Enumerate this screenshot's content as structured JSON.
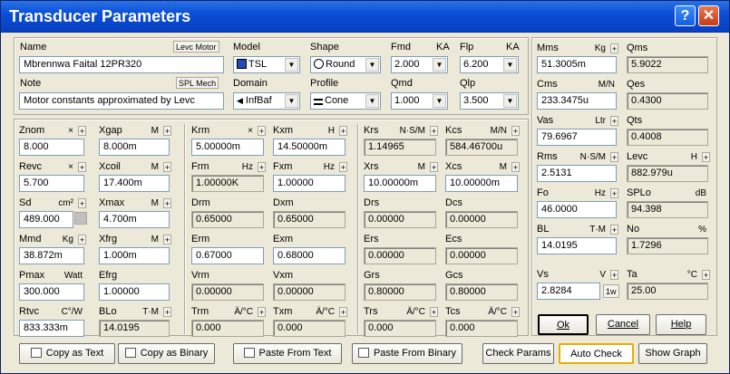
{
  "window": {
    "title": "Transducer Parameters",
    "help_glyph": "?",
    "close_glyph": "✕"
  },
  "top": {
    "name_label": "Name",
    "name_value": "Mbrennwa Faital 12PR320",
    "levc_motor_btn": "Levc Motor",
    "note_label": "Note",
    "note_value": "Motor constants approximated by Levc",
    "spl_mech_btn": "SPL Mech",
    "model_label": "Model",
    "model_value": "TSL",
    "domain_label": "Domain",
    "domain_value": "InfBaf",
    "shape_label": "Shape",
    "shape_value": "Round",
    "profile_label": "Profile",
    "profile_value": "Cone",
    "fmd_label": "Fmd",
    "fmd_unit": "KA",
    "fmd_value": "2.000",
    "qmd_label": "Qmd",
    "qmd_value": "1.000",
    "flp_label": "Flp",
    "flp_unit": "KA",
    "flp_value": "6.200",
    "qlp_label": "Qlp",
    "qlp_value": "3.500"
  },
  "col1": {
    "znom": {
      "label": "Znom",
      "unit": "×",
      "value": "8.000"
    },
    "revc": {
      "label": "Revc",
      "unit": "×",
      "value": "5.700"
    },
    "sd": {
      "label": "Sd",
      "unit": "cm²",
      "value": "489.000"
    },
    "mmd": {
      "label": "Mmd",
      "unit": "Kg",
      "value": "38.872m"
    },
    "pmax": {
      "label": "Pmax",
      "unit": "Watt",
      "value": "300.000"
    },
    "rtvc": {
      "label": "Rtvc",
      "unit": "C°/W",
      "value": "833.333m"
    }
  },
  "col2": {
    "xgap": {
      "label": "Xgap",
      "unit": "M",
      "value": "8.000m"
    },
    "xcoil": {
      "label": "Xcoil",
      "unit": "M",
      "value": "17.400m"
    },
    "xmax": {
      "label": "Xmax",
      "unit": "M",
      "value": "4.700m"
    },
    "xfrg": {
      "label": "Xfrg",
      "unit": "M",
      "value": "1.000m"
    },
    "efrg": {
      "label": "Efrg",
      "unit": "",
      "value": "1.00000"
    },
    "blo": {
      "label": "BLo",
      "unit": "T·M",
      "value": "14.0195"
    }
  },
  "col3": {
    "krm": {
      "label": "Krm",
      "unit": "×",
      "value": "5.00000m"
    },
    "frm": {
      "label": "Frm",
      "unit": "Hz",
      "value": "1.00000K"
    },
    "drm": {
      "label": "Drm",
      "unit": "",
      "value": "0.65000"
    },
    "erm": {
      "label": "Erm",
      "unit": "",
      "value": "0.67000"
    },
    "vrm": {
      "label": "Vrm",
      "unit": "",
      "value": "0.00000"
    },
    "trm": {
      "label": "Trm",
      "unit": "Ä/°C",
      "value": "0.000"
    }
  },
  "col4": {
    "kxm": {
      "label": "Kxm",
      "unit": "H",
      "value": "14.50000m"
    },
    "fxm": {
      "label": "Fxm",
      "unit": "Hz",
      "value": "1.00000"
    },
    "dxm": {
      "label": "Dxm",
      "unit": "",
      "value": "0.65000"
    },
    "exm": {
      "label": "Exm",
      "unit": "",
      "value": "0.68000"
    },
    "vxm": {
      "label": "Vxm",
      "unit": "",
      "value": "0.00000"
    },
    "txm": {
      "label": "Txm",
      "unit": "Ä/°C",
      "value": "0.000"
    }
  },
  "col5": {
    "krs": {
      "label": "Krs",
      "unit": "N·S/M",
      "value": "1.14965"
    },
    "xrs": {
      "label": "Xrs",
      "unit": "M",
      "value": "10.00000m"
    },
    "drs": {
      "label": "Drs",
      "unit": "",
      "value": "0.00000"
    },
    "ers": {
      "label": "Ers",
      "unit": "",
      "value": "0.00000"
    },
    "grs": {
      "label": "Grs",
      "unit": "",
      "value": "0.80000"
    },
    "trs": {
      "label": "Trs",
      "unit": "Ä/°C",
      "value": "0.000"
    }
  },
  "col6": {
    "kcs": {
      "label": "Kcs",
      "unit": "M/N",
      "value": "584.46700u"
    },
    "xcs": {
      "label": "Xcs",
      "unit": "M",
      "value": "10.00000m"
    },
    "dcs": {
      "label": "Dcs",
      "unit": "",
      "value": "0.00000"
    },
    "ecs": {
      "label": "Ecs",
      "unit": "",
      "value": "0.00000"
    },
    "gcs": {
      "label": "Gcs",
      "unit": "",
      "value": "0.80000"
    },
    "tcs": {
      "label": "Tcs",
      "unit": "Ä/°C",
      "value": "0.000"
    }
  },
  "right": {
    "mms": {
      "label": "Mms",
      "unit": "Kg",
      "value": "51.3005m"
    },
    "qms": {
      "label": "Qms",
      "value": "5.9022"
    },
    "cms": {
      "label": "Cms",
      "unit": "M/N",
      "value": "233.3475u"
    },
    "qes": {
      "label": "Qes",
      "value": "0.4300"
    },
    "vas": {
      "label": "Vas",
      "unit": "Ltr",
      "value": "79.6967"
    },
    "qts": {
      "label": "Qts",
      "value": "0.4008"
    },
    "rms": {
      "label": "Rms",
      "unit": "N·S/M",
      "value": "2.5131"
    },
    "levc": {
      "label": "Levc",
      "unit": "H",
      "value": "882.979u"
    },
    "fo": {
      "label": "Fo",
      "unit": "Hz",
      "value": "46.0000"
    },
    "splo": {
      "label": "SPLo",
      "unit": "dB",
      "value": "94.398"
    },
    "bl": {
      "label": "BL",
      "unit": "T·M",
      "value": "14.0195"
    },
    "no": {
      "label": "No",
      "unit": "%",
      "value": "1.7296"
    },
    "vs": {
      "label": "Vs",
      "unit": "V",
      "value": "2.8284",
      "btn": "1w"
    },
    "ta": {
      "label": "Ta",
      "unit": "°C",
      "value": "25.00"
    }
  },
  "buttons": {
    "ok": "Ok",
    "cancel": "Cancel",
    "help": "Help",
    "copy_text": "Copy as Text",
    "copy_binary": "Copy as Binary",
    "paste_text": "Paste From Text",
    "paste_binary": "Paste From Binary",
    "check_params": "Check Params",
    "auto_check": "Auto Check",
    "show_graph": "Show Graph"
  }
}
